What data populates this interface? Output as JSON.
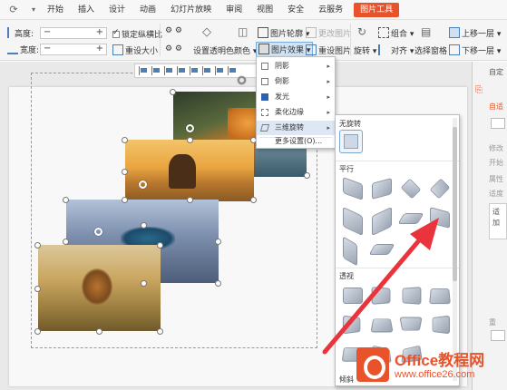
{
  "tabs": [
    "开始",
    "插入",
    "设计",
    "动画",
    "幻灯片放映",
    "审阅",
    "视图",
    "安全",
    "云服务",
    "图片工具"
  ],
  "ribbon": {
    "height_label": "高度:",
    "width_label": "宽度:",
    "lock_ratio": "锁定纵横比",
    "reset_size": "重设大小",
    "set_transparent": "设置透明色",
    "color": "颜色",
    "outline": "图片轮廓",
    "effects": "图片效果",
    "change_pic": "更改图片",
    "reset_pic": "重设图片",
    "rotate": "旋转",
    "group": "组合",
    "align": "对齐",
    "select_pane": "选择窗格",
    "bring_forward": "上移一层",
    "send_backward": "下移一层"
  },
  "menu": {
    "items": [
      "阴影",
      "倒影",
      "发光",
      "柔化边缘",
      "三维旋转",
      "更多设置(O)..."
    ]
  },
  "gallery": {
    "sec_none": "无旋转",
    "sec_parallel": "平行",
    "sec_perspective": "透视",
    "sec_oblique": "倾斜"
  },
  "sidepane": {
    "t1": "自定",
    "t2": "自适",
    "t3": "修改",
    "t4": "开始",
    "t5": "属性",
    "t6": "适度",
    "t7": "适",
    "t8": "加",
    "t9": "重"
  },
  "watermark": {
    "brand": "Office教程网",
    "url": "www.office26.com"
  },
  "colors": {
    "accent": "#e9532b",
    "arrow": "#e8343a"
  }
}
